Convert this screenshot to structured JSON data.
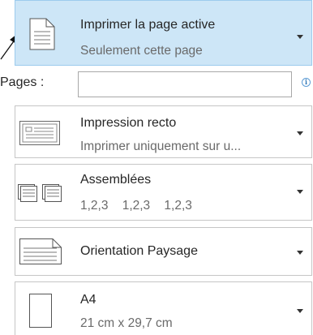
{
  "print_page": {
    "title": "Imprimer la page active",
    "subtitle": "Seulement cette page",
    "icon": "document-icon"
  },
  "pages": {
    "label": "Pages :",
    "value": "",
    "placeholder": "",
    "info_icon": "i"
  },
  "sides": {
    "title": "Impression recto",
    "subtitle": "Imprimer uniquement sur u...",
    "icon": "single-sided-icon"
  },
  "collation": {
    "title": "Assemblées",
    "subtitle": "1,2,3    1,2,3    1,2,3",
    "icon": "collated-icon"
  },
  "orientation": {
    "title": "Orientation Paysage",
    "icon": "landscape-icon"
  },
  "paper": {
    "title": "A4",
    "subtitle": "21 cm x 29,7 cm",
    "icon": "paper-size-icon"
  },
  "colors": {
    "active_bg": "#cde6f7",
    "active_border": "#9ccbed",
    "border": "#c6c6c6",
    "info": "#2e75b6"
  }
}
